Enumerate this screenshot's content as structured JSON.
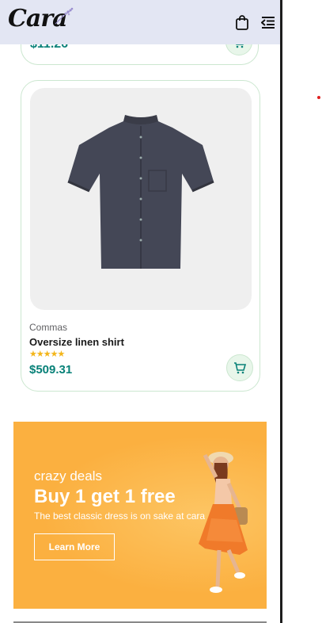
{
  "header": {
    "logo_text": "Cara"
  },
  "top_card": {
    "price": "$11.26"
  },
  "product": {
    "brand": "Commas",
    "name": "Oversize linen shirt",
    "stars": "★★★★★",
    "rating": 5,
    "price": "$509.31"
  },
  "banner": {
    "eyebrow": "crazy deals",
    "headline": "Buy 1 get 1 free",
    "subtitle": "The best classic dress is on sake at cara",
    "button_label": "Learn More"
  },
  "colors": {
    "header_bg": "#e3e6f3",
    "accent": "#088178",
    "banner_bg": "#fbb040",
    "star": "#f3b519"
  },
  "icons": [
    "bag-icon",
    "menu-icon",
    "cart-icon",
    "star-icon"
  ]
}
